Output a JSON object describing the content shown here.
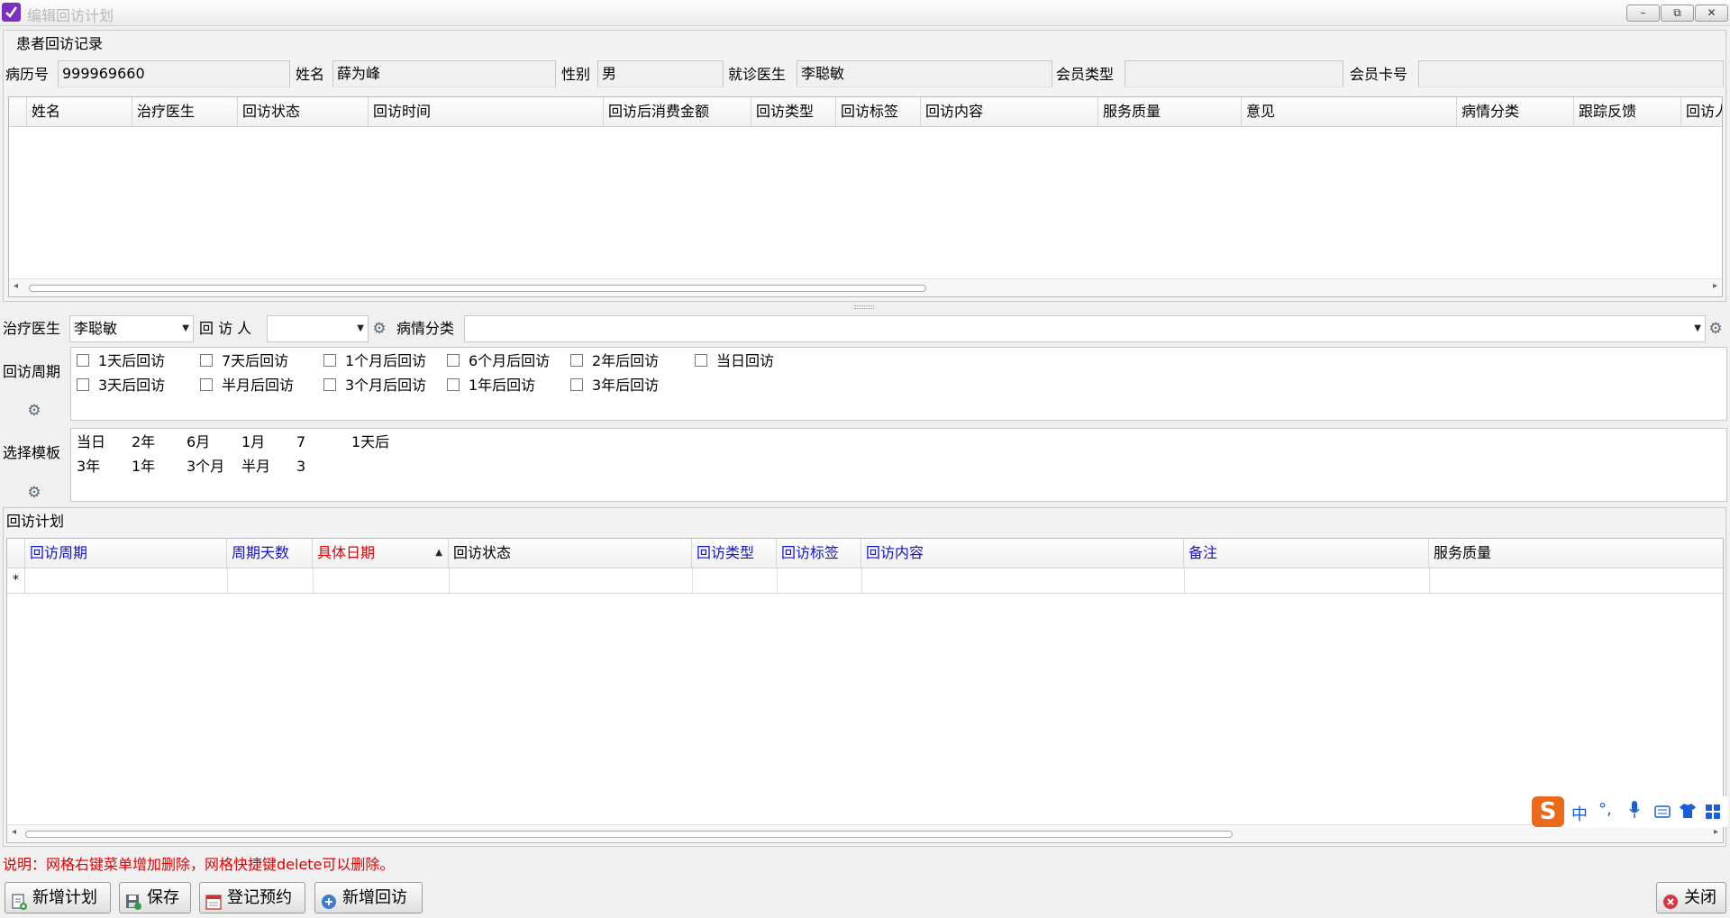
{
  "window": {
    "title": "编辑回访计划",
    "min": "–",
    "restore": "⧉",
    "close": "✕"
  },
  "record_section": {
    "title": "患者回访记录",
    "fields": [
      {
        "label": "病历号",
        "value": "999969660"
      },
      {
        "label": "姓名",
        "value": "薛为峰"
      },
      {
        "label": "性别",
        "value": "男"
      },
      {
        "label": "就诊医生",
        "value": "李聪敏"
      },
      {
        "label": "会员类型",
        "value": ""
      },
      {
        "label": "会员卡号",
        "value": ""
      }
    ],
    "columns": [
      "姓名",
      "治疗医生",
      "回访状态",
      "回访时间",
      "回访后消费金额",
      "回访类型",
      "回访标签",
      "回访内容",
      "服务质量",
      "意见",
      "病情分类",
      "跟踪反馈",
      "回访人"
    ]
  },
  "form": {
    "doctor_label": "治疗医生",
    "doctor_value": "李聪敏",
    "visitor_label": "回 访 人",
    "visitor_value": "",
    "category_label": "病情分类",
    "category_value": ""
  },
  "cycle": {
    "label": "回访周期",
    "row1": [
      "1天后回访",
      "7天后回访",
      "1个月后回访",
      "6个月后回访",
      "2年后回访",
      "当日回访"
    ],
    "row2": [
      "3天后回访",
      "半月后回访",
      "3个月后回访",
      "1年后回访",
      "3年后回访"
    ]
  },
  "template": {
    "label": "选择模板",
    "row1": [
      "当日",
      "2年",
      "6月",
      "1月",
      "7",
      "1天后"
    ],
    "row2": [
      "3年",
      "1年",
      "3个月",
      "半月",
      "3"
    ]
  },
  "plan": {
    "title": "回访计划",
    "columns": [
      {
        "label": "回访周期",
        "color": "#1414c8"
      },
      {
        "label": "周期天数",
        "color": "#1414c8"
      },
      {
        "label": "具体日期",
        "color": "#e00000"
      },
      {
        "label": "回访状态",
        "color": "#000000"
      },
      {
        "label": "回访类型",
        "color": "#1414c8"
      },
      {
        "label": "回访标签",
        "color": "#1414c8"
      },
      {
        "label": "回访内容",
        "color": "#1414c8"
      },
      {
        "label": "备注",
        "color": "#1414c8"
      },
      {
        "label": "服务质量",
        "color": "#000000"
      }
    ],
    "new_row_marker": "*"
  },
  "note": "说明：网格右键菜单增加删除，网格快捷键delete可以删除。",
  "buttons": {
    "new_plan": "新增计划",
    "save": "保存",
    "register": "登记预约",
    "new_visit": "新增回访",
    "close": "关闭"
  },
  "ime": {
    "logo": "S",
    "lang": "中",
    "punct": "°,"
  }
}
